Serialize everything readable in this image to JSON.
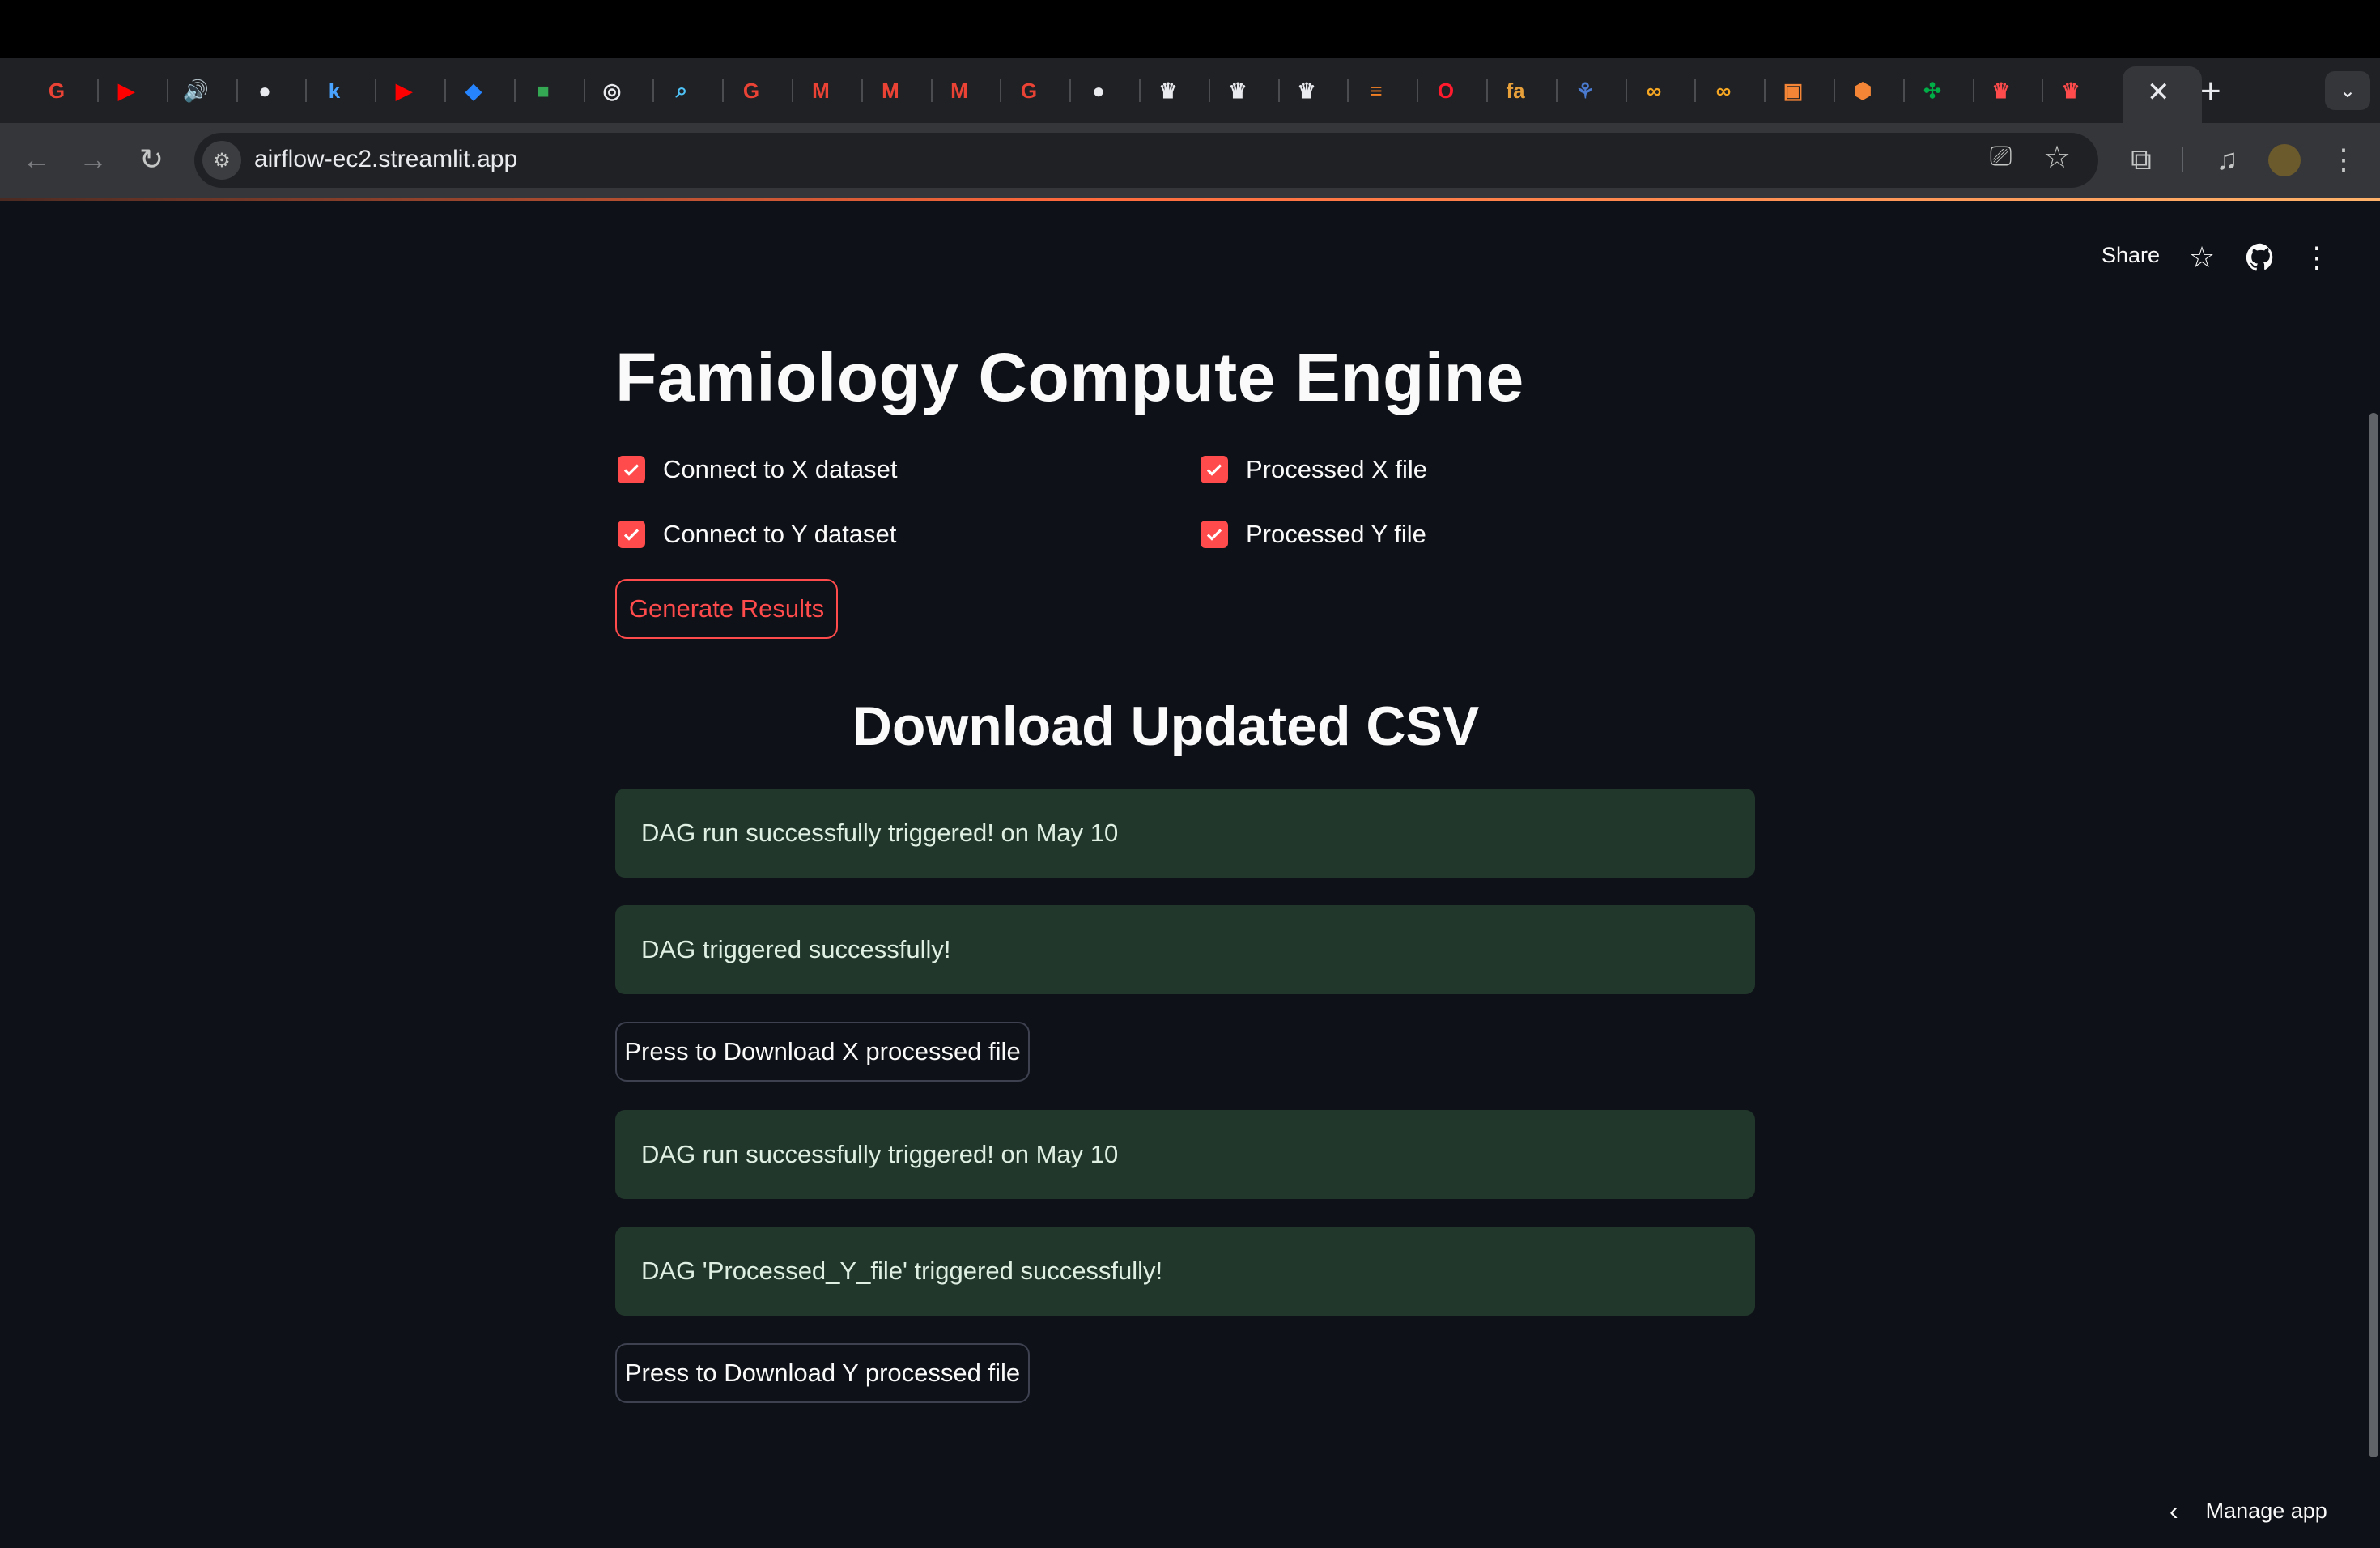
{
  "browser": {
    "url": "airflow-ec2.streamlit.app",
    "tabs": [
      {
        "icon": "google-icon",
        "glyph": "G",
        "color": "#ea4335"
      },
      {
        "icon": "youtube-icon",
        "glyph": "▶",
        "color": "#ff0000"
      },
      {
        "icon": "audio-playing-icon",
        "glyph": "🔊",
        "color": "#c4c7c5"
      },
      {
        "icon": "github-icon",
        "glyph": "●",
        "color": "#e8eaed"
      },
      {
        "icon": "k-icon",
        "glyph": "k",
        "color": "#4aa3ff"
      },
      {
        "icon": "youtube-icon",
        "glyph": "▶",
        "color": "#ff0000"
      },
      {
        "icon": "jira-icon",
        "glyph": "◆",
        "color": "#2684ff"
      },
      {
        "icon": "sheet-icon",
        "glyph": "■",
        "color": "#34a853"
      },
      {
        "icon": "openai-icon",
        "glyph": "◎",
        "color": "#e8eaed"
      },
      {
        "icon": "search-tab-icon",
        "glyph": "⌕",
        "color": "#4fc3f7"
      },
      {
        "icon": "google-icon",
        "glyph": "G",
        "color": "#ea4335"
      },
      {
        "icon": "gmail-icon",
        "glyph": "M",
        "color": "#ea4335"
      },
      {
        "icon": "gmail-icon",
        "glyph": "M",
        "color": "#ea4335"
      },
      {
        "icon": "gmail-icon",
        "glyph": "M",
        "color": "#ea4335"
      },
      {
        "icon": "google-icon",
        "glyph": "G",
        "color": "#ea4335"
      },
      {
        "icon": "github-icon",
        "glyph": "●",
        "color": "#e8eaed"
      },
      {
        "icon": "streamlit-crown-icon",
        "glyph": "♛",
        "color": "#e8eaed"
      },
      {
        "icon": "streamlit-crown-icon",
        "glyph": "♛",
        "color": "#e8eaed"
      },
      {
        "icon": "streamlit-crown-icon",
        "glyph": "♛",
        "color": "#e8eaed"
      },
      {
        "icon": "stackoverflow-icon",
        "glyph": "≡",
        "color": "#f48024"
      },
      {
        "icon": "opera-icon",
        "glyph": "O",
        "color": "#ff1b2d"
      },
      {
        "icon": "fa-icon",
        "glyph": "fa",
        "color": "#e8a13a"
      },
      {
        "icon": "plant-icon",
        "glyph": "⚘",
        "color": "#4a7bd0"
      },
      {
        "icon": "infinity-icon",
        "glyph": "∞",
        "color": "#f5a623"
      },
      {
        "icon": "infinity-icon",
        "glyph": "∞",
        "color": "#f5a623"
      },
      {
        "icon": "aws-icon",
        "glyph": "▣",
        "color": "#f58536"
      },
      {
        "icon": "box-icon",
        "glyph": "⬢",
        "color": "#f58536"
      },
      {
        "icon": "airflow-icon",
        "glyph": "✣",
        "color": "#00ad46"
      },
      {
        "icon": "streamlit-crown-icon",
        "glyph": "♛",
        "color": "#ff4b4b"
      },
      {
        "icon": "streamlit-crown-icon",
        "glyph": "♛",
        "color": "#ff4b4b"
      }
    ]
  },
  "header": {
    "share_label": "Share"
  },
  "main": {
    "title": "Famiology Compute Engine",
    "checkboxes": [
      {
        "label": "Connect to X dataset",
        "checked": true
      },
      {
        "label": "Processed X file",
        "checked": true
      },
      {
        "label": "Connect to Y dataset",
        "checked": true
      },
      {
        "label": "Processed Y file",
        "checked": true
      }
    ],
    "generate_label": "Generate Results",
    "section_title": "Download Updated CSV",
    "alerts": [
      "DAG run successfully triggered! on May 10",
      "DAG triggered successfully!",
      "DAG run successfully triggered! on May 10",
      "DAG 'Processed_Y_file' triggered successfully!"
    ],
    "download_x_label": "Press to Download X processed file",
    "download_y_label": "Press to Download Y processed file"
  },
  "footer": {
    "manage_app_label": "Manage app"
  },
  "colors": {
    "primary": "#ff4b4b",
    "background": "#0e1117",
    "success_bg": "#21372b"
  }
}
